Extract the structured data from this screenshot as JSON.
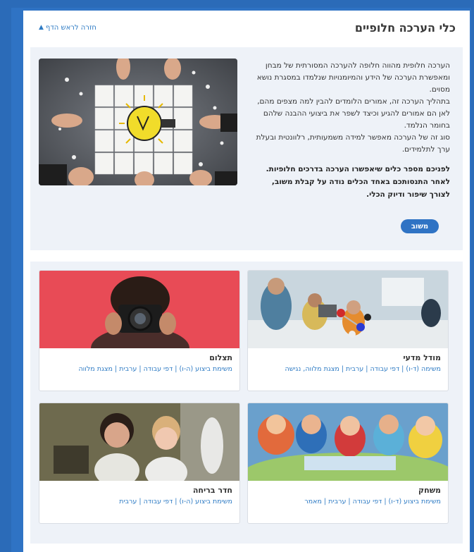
{
  "header": {
    "title": "כלי הערכה חלופיים",
    "back_link": "חזרה לראש הדף"
  },
  "intro": {
    "paragraphs": [
      "הערכה חלופית מהווה חלופה להערכה המסורתית של מבחן ומאפשרת הערכה של הידע והמיומנויות שנלמדו במסגרת נושא מסוים.",
      "בתהליך הערכה זה, אמורים הלומדים להבין למה מצפים מהם, לאן הם אמורים להגיע וכיצד לשפר את ביצועי ההבנה שלהם בחומר הנלמד.",
      "סוג זה של הערכה מאפשר למידה משמעותית, רלוונטית ובעלת ערך לתלמידים."
    ],
    "bold_text": "לפניכם מספר כלים שיאפשרו הערכה בדרכים חלופיות. לאחר התנסותכם באחד הכלים נודה על קבלת משוב, לצורך שיפור ודיוק הכלי.",
    "button_label": "משוב"
  },
  "cards": [
    {
      "title": "מודל מדעי",
      "tags": "משימה (ד-ו) | דפי עבודה | ערבית | מצגת מלווה, נגישה"
    },
    {
      "title": "תצלום",
      "tags": "משימת ביצוע (ה-ו) | דפי עבודה | ערבית | מצגת מלווה"
    },
    {
      "title": "משחק",
      "tags": "משימת ביצוע (ד-ו) | דפי עבודה | ערבית | מאמר"
    },
    {
      "title": "חדר בריחה",
      "tags": "משימת ביצוע (ה-ו) | דפי עבודה | ערבית"
    }
  ],
  "colors": {
    "accent": "#2f73c4",
    "link": "#2e7bc4",
    "panel_bg": "#eef2f8",
    "page_bg": "#2b6bb8"
  }
}
